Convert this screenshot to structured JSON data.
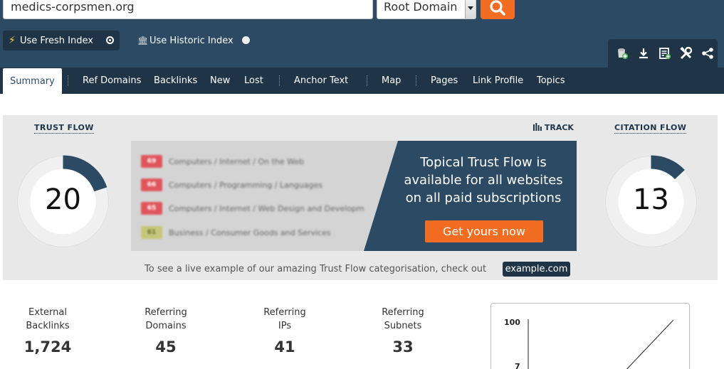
{
  "search": {
    "value": "medics-corpsmen.org",
    "scope": "Root Domain"
  },
  "index": {
    "fresh_label": "Use Fresh Index",
    "historic_label": "Use Historic Index"
  },
  "nav": {
    "tabs": [
      "Summary",
      "Ref Domains",
      "Backlinks",
      "New",
      "Lost",
      "Anchor Text",
      "Map",
      "Pages",
      "Link Profile",
      "Topics"
    ],
    "active": "Summary"
  },
  "trust_flow": {
    "title": "TRUST FLOW",
    "value": "20",
    "fraction": 0.2
  },
  "citation_flow": {
    "title": "CITATION FLOW",
    "value": "13",
    "fraction": 0.13
  },
  "track_label": "TRACK",
  "topical": {
    "topics": [
      {
        "score": "69",
        "label": "Computers / Internet / On the Web",
        "color": "#e0555c"
      },
      {
        "score": "66",
        "label": "Computers / Programming / Languages",
        "color": "#e0555c"
      },
      {
        "score": "65",
        "label": "Computers / Internet / Web Design and Developm",
        "color": "#e0555c"
      },
      {
        "score": "61",
        "label": "Business / Consumer Goods and Services",
        "color": "#c6c67a"
      }
    ],
    "promo_line1": "Topical Trust Flow is",
    "promo_line2": "available for all websites",
    "promo_line3": "on all paid subscriptions",
    "cta_label": "Get yours now"
  },
  "example": {
    "text": "To see a live example of our amazing Trust Flow categorisation, check out",
    "link_label": "example.com"
  },
  "stats": [
    {
      "line1": "External",
      "line2": "Backlinks",
      "value": "1,724"
    },
    {
      "line1": "Referring",
      "line2": "Domains",
      "value": "45"
    },
    {
      "line1": "Referring",
      "line2": "IPs",
      "value": "41"
    },
    {
      "line1": "Referring",
      "line2": "Subnets",
      "value": "33"
    }
  ],
  "mini_chart": {
    "y_top_label": "100",
    "y_low_label": "7"
  },
  "colors": {
    "header": "#2c4a63",
    "nav": "#1f3447",
    "accent": "#f26d21",
    "gauge_fill": "#2c4a63"
  }
}
